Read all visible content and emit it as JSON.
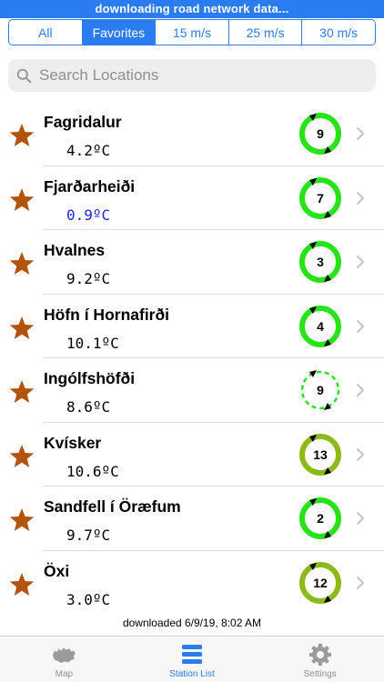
{
  "banner": {
    "text": "downloading road network data..."
  },
  "filters": [
    {
      "label": "All",
      "active": false
    },
    {
      "label": "Favorites",
      "active": true
    },
    {
      "label": "15 m/s",
      "active": false
    },
    {
      "label": "25 m/s",
      "active": false
    },
    {
      "label": "30 m/s",
      "active": false
    }
  ],
  "search": {
    "placeholder": "Search Locations",
    "value": ""
  },
  "colors": {
    "accent": "#2b7bf1",
    "star": "#b3540d",
    "gauge_bright": "#29e31a",
    "gauge_olive": "#8dba18",
    "cold_temp": "#1a23e0"
  },
  "stations": [
    {
      "name": "Fagridalur",
      "temp": "4.2ºC",
      "cold": false,
      "gauge": "9",
      "ring": "bright",
      "dashed": false,
      "favorite": true
    },
    {
      "name": "Fjarðarheiði",
      "temp": "0.9ºC",
      "cold": true,
      "gauge": "7",
      "ring": "bright",
      "dashed": false,
      "favorite": true
    },
    {
      "name": "Hvalnes",
      "temp": "9.2ºC",
      "cold": false,
      "gauge": "3",
      "ring": "bright",
      "dashed": false,
      "favorite": true
    },
    {
      "name": "Höfn í Hornafirði",
      "temp": "10.1ºC",
      "cold": false,
      "gauge": "4",
      "ring": "bright",
      "dashed": false,
      "favorite": true
    },
    {
      "name": "Ingólfshöfði",
      "temp": "8.6ºC",
      "cold": false,
      "gauge": "9",
      "ring": "bright",
      "dashed": true,
      "favorite": true
    },
    {
      "name": "Kvísker",
      "temp": "10.6ºC",
      "cold": false,
      "gauge": "13",
      "ring": "olive",
      "dashed": false,
      "favorite": true
    },
    {
      "name": "Sandfell í Öræfum",
      "temp": "9.7ºC",
      "cold": false,
      "gauge": "2",
      "ring": "bright",
      "dashed": false,
      "favorite": true
    },
    {
      "name": "Öxi",
      "temp": "3.0ºC",
      "cold": false,
      "gauge": "12",
      "ring": "olive",
      "dashed": false,
      "favorite": true
    }
  ],
  "status": {
    "downloaded": "downloaded 6/9/19, 8:02 AM"
  },
  "tabs": [
    {
      "label": "Map",
      "icon": "iceland-map-icon",
      "active": false
    },
    {
      "label": "Station List",
      "icon": "list-icon",
      "active": true
    },
    {
      "label": "Settings",
      "icon": "gear-icon",
      "active": false
    }
  ]
}
